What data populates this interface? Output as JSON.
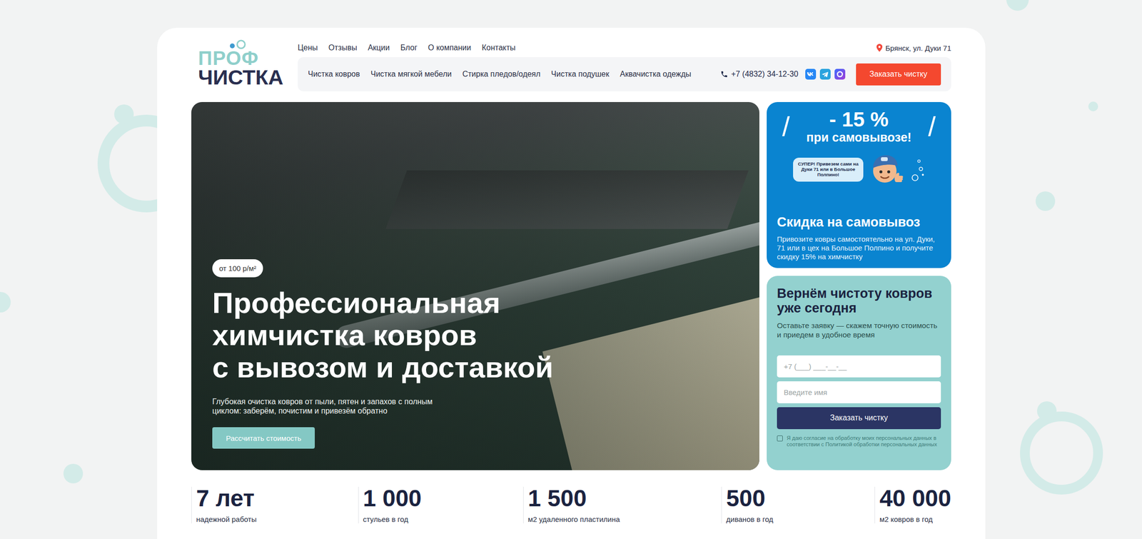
{
  "logo": {
    "top": "ПРОФ",
    "bottom": "ЧИСТКА"
  },
  "top_nav": [
    "Цены",
    "Отзывы",
    "Акции",
    "Блог",
    "О компании",
    "Контакты"
  ],
  "location": "Брянск, ул. Дуки 71",
  "services_nav": [
    "Чистка ковров",
    "Чистка мягкой мебели",
    "Стирка пледов/одеял",
    "Чистка подушек",
    "Аквачистка одежды"
  ],
  "phone": "+7 (4832) 34-12-30",
  "order_button": "Заказать чистку",
  "hero": {
    "badge": "от 100 р/м²",
    "title": [
      "Профессиональная",
      "химчистка ковров",
      "с вывозом и доставкой"
    ],
    "description": "Глубокая очистка ковров от пыли, пятен и запахов с полным циклом: заберём, почистим и привезём обратно",
    "button": "Рассчитать стоимость"
  },
  "promo": {
    "slash": "/",
    "discount": "- 15 %",
    "subtitle": "при самовывозе!",
    "bubble": "СУПЕР! Привезем сами на Дуки 71 или в Большое Полпино!",
    "title": "Скидка на самовывоз",
    "text": "Привозите ковры самостоятельно на ул. Дуки, 71 или в цех на Большое Полпино и получите скидку 15% на химчистку"
  },
  "form": {
    "title": "Вернём чистоту ковров уже сегодня",
    "text": "Оставьте заявку — скажем точную стоимость и приедем в удобное время",
    "phone_placeholder": "+7 (___) ___-__-__",
    "name_placeholder": "Введите имя",
    "button": "Заказать чистку",
    "consent": {
      "checked": false,
      "text": "Я даю согласие на обработку моих персональных данных в соответствии с Политикой обработки персональных данных"
    }
  },
  "stats": [
    {
      "value": "7 лет",
      "label": "надежной работы"
    },
    {
      "value": "1 000",
      "label": "стульев в год"
    },
    {
      "value": "1 500",
      "label": "м2 удаленного пластилина"
    },
    {
      "value": "500",
      "label": "диванов в год"
    },
    {
      "value": "40 000",
      "label": "м2 ковров в год"
    }
  ]
}
